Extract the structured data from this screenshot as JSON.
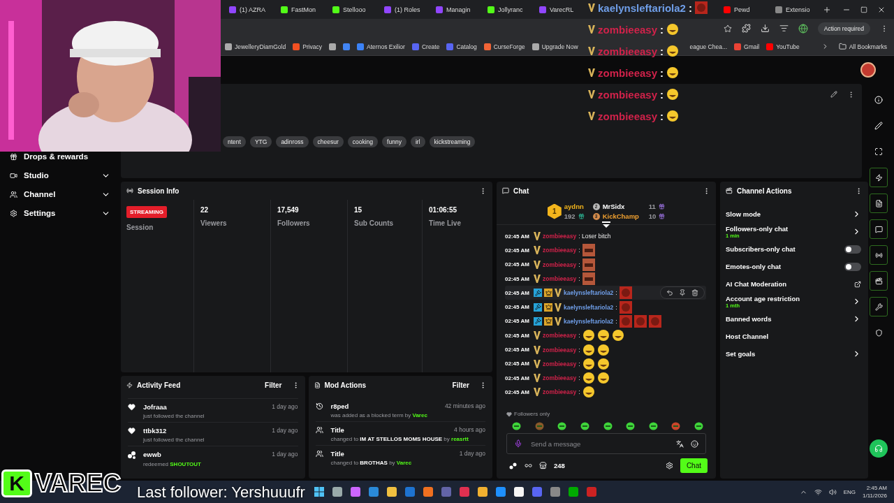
{
  "browser": {
    "tabs": [
      {
        "label": "(1) AZRA",
        "kind": "twitch"
      },
      {
        "label": "FastMon",
        "kind": "kick"
      },
      {
        "label": "Stellooo",
        "kind": "kick"
      },
      {
        "label": "(1) Roles",
        "kind": "twitch"
      },
      {
        "label": "Managin",
        "kind": "twitch"
      },
      {
        "label": "Jollyranc",
        "kind": "kick"
      },
      {
        "label": "VarecRL",
        "kind": "twitch"
      },
      {
        "label": "Pewd",
        "kind": "youtube"
      },
      {
        "label": "Extensio",
        "kind": "puzzle"
      }
    ],
    "action_required": "Action required",
    "bookmarks": [
      {
        "label": "JewelleryDiamGold",
        "kind": "globe"
      },
      {
        "label": "Privacy",
        "kind": "windows"
      },
      {
        "kind": "globe"
      },
      {
        "kind": "google"
      },
      {
        "label": "Aternos Exilior",
        "kind": "square"
      },
      {
        "label": "Create",
        "kind": "roblox"
      },
      {
        "label": "Catalog",
        "kind": "roblox"
      },
      {
        "label": "CurseForge",
        "kind": "curseforge"
      },
      {
        "label": "Upgrade Now",
        "kind": "globe"
      },
      {
        "label": "eague Chea...",
        "kind": "none"
      },
      {
        "label": "Gmail",
        "kind": "gmail"
      },
      {
        "label": "YouTube",
        "kind": "youtube"
      }
    ],
    "all_bookmarks": "All Bookmarks"
  },
  "sidebar": {
    "items": [
      {
        "label": "Drops & rewards",
        "kind": "gift",
        "expandable": false
      },
      {
        "label": "Studio",
        "kind": "studio",
        "expandable": true
      },
      {
        "label": "Channel",
        "kind": "channel",
        "expandable": true
      },
      {
        "label": "Settings",
        "kind": "settings",
        "expandable": true
      }
    ]
  },
  "stream_info": {
    "tags": [
      "ntent",
      "YTG",
      "adinross",
      "cheesur",
      "cooking",
      "funny",
      "irl",
      "kickstreaming"
    ]
  },
  "session_info": {
    "title": "Session Info",
    "status": "STREAMING",
    "session_label": "Session",
    "stats": [
      {
        "value": "22",
        "label": "Viewers"
      },
      {
        "value": "17,549",
        "label": "Followers"
      },
      {
        "value": "15",
        "label": "Sub Counts"
      },
      {
        "value": "01:06:55",
        "label": "Time Live"
      }
    ]
  },
  "chat": {
    "title": "Chat",
    "leaderboard": [
      {
        "rank": "1",
        "name": "aydnn",
        "count": "192"
      },
      {
        "rank": "2",
        "name": "MrSidx",
        "count": "11"
      },
      {
        "rank": "3",
        "name": "KickChamp",
        "count": "10"
      }
    ],
    "messages": [
      {
        "time": "02:45 AM",
        "badges": [
          {
            "kind": "vip"
          }
        ],
        "user": "zombieeasy",
        "color": "#d0224a",
        "text": ": Loser bitch",
        "selected": false
      },
      {
        "time": "02:45 AM",
        "badges": [
          {
            "kind": "vip"
          }
        ],
        "user": "zombieeasy",
        "color": "#d0224a",
        "text": ":",
        "emotes": [
          {
            "kind": "face"
          }
        ],
        "selected": false
      },
      {
        "time": "02:45 AM",
        "badges": [
          {
            "kind": "vip"
          }
        ],
        "user": "zombieeasy",
        "color": "#d0224a",
        "text": ":",
        "emotes": [
          {
            "kind": "face"
          }
        ],
        "selected": false
      },
      {
        "time": "02:45 AM",
        "badges": [
          {
            "kind": "vip"
          }
        ],
        "user": "zombieeasy",
        "color": "#d0224a",
        "text": ":",
        "emotes": [
          {
            "kind": "face"
          }
        ],
        "selected": false
      },
      {
        "time": "02:45 AM",
        "badges": [
          {
            "kind": "mod"
          },
          {
            "kind": "crown"
          },
          {
            "kind": "vip"
          }
        ],
        "user": "kaelynsleftariola2",
        "color": "#6f9ee8",
        "text": ":",
        "emotes": [
          {
            "kind": "red"
          }
        ],
        "selected": true
      },
      {
        "time": "02:45 AM",
        "badges": [
          {
            "kind": "mod"
          },
          {
            "kind": "crown"
          },
          {
            "kind": "vip"
          }
        ],
        "user": "kaelynsleftariola2",
        "color": "#6f9ee8",
        "text": ":",
        "emotes": [
          {
            "kind": "red"
          }
        ],
        "selected": false
      },
      {
        "time": "02:45 AM",
        "badges": [
          {
            "kind": "mod"
          },
          {
            "kind": "crown"
          },
          {
            "kind": "vip"
          }
        ],
        "user": "kaelynsleftariola2",
        "color": "#6f9ee8",
        "text": ":",
        "emotes": [
          {
            "kind": "red"
          },
          {
            "kind": "red"
          },
          {
            "kind": "red"
          }
        ],
        "selected": false
      },
      {
        "time": "02:45 AM",
        "badges": [
          {
            "kind": "vip"
          }
        ],
        "user": "zombieeasy",
        "color": "#d0224a",
        "text": ":",
        "emotes": [
          {
            "kind": "laugh"
          },
          {
            "kind": "laugh"
          },
          {
            "kind": "laugh"
          }
        ],
        "selected": false
      },
      {
        "time": "02:45 AM",
        "badges": [
          {
            "kind": "vip"
          }
        ],
        "user": "zombieeasy",
        "color": "#d0224a",
        "text": ":",
        "emotes": [
          {
            "kind": "laugh"
          },
          {
            "kind": "laugh"
          }
        ],
        "selected": false
      },
      {
        "time": "02:45 AM",
        "badges": [
          {
            "kind": "vip"
          }
        ],
        "user": "zombieeasy",
        "color": "#d0224a",
        "text": ":",
        "emotes": [
          {
            "kind": "laugh"
          },
          {
            "kind": "laugh"
          }
        ],
        "selected": false
      },
      {
        "time": "02:45 AM",
        "badges": [
          {
            "kind": "vip"
          }
        ],
        "user": "zombieeasy",
        "color": "#d0224a",
        "text": ":",
        "emotes": [
          {
            "kind": "laugh"
          },
          {
            "kind": "laugh"
          }
        ],
        "selected": false
      },
      {
        "time": "02:45 AM",
        "badges": [
          {
            "kind": "vip"
          }
        ],
        "user": "zombieeasy",
        "color": "#d0224a",
        "text": ":",
        "emotes": [
          {
            "kind": "laugh"
          }
        ],
        "selected": false
      }
    ],
    "followers_only": "Followers only",
    "placeholder": "Send a message",
    "points": "248",
    "send": "Chat"
  },
  "channel_actions": {
    "title": "Channel Actions",
    "items": [
      {
        "label": "Slow mode",
        "kind": "arrow"
      },
      {
        "label": "Followers-only chat",
        "sub": "1 min",
        "kind": "arrow"
      },
      {
        "label": "Subscribers-only chat",
        "kind": "toggle",
        "on": false
      },
      {
        "label": "Emotes-only chat",
        "kind": "toggle",
        "on": false
      },
      {
        "label": "AI Chat Moderation",
        "kind": "external"
      },
      {
        "label": "Account age restriction",
        "sub": "1 mth",
        "kind": "arrow"
      },
      {
        "label": "Banned words",
        "kind": "arrow"
      },
      {
        "label": "Host Channel",
        "kind": "plain"
      },
      {
        "label": "Set goals",
        "kind": "arrow"
      }
    ]
  },
  "activity_feed": {
    "title": "Activity Feed",
    "filter": "Filter",
    "items": [
      {
        "kind": "follow",
        "name": "Jofraaa",
        "detail": "just followed the channel",
        "time": "1 day ago"
      },
      {
        "kind": "follow",
        "name": "ttbk312",
        "detail": "just followed the channel",
        "time": "1 day ago"
      },
      {
        "kind": "redeem",
        "name": "ewwb",
        "detail": "redeemed",
        "highlight": "SHOUTOUT",
        "time": "1 day ago"
      }
    ]
  },
  "mod_actions": {
    "title": "Mod Actions",
    "filter": "Filter",
    "items": [
      {
        "kind": "blocked",
        "name": "r8ped",
        "detail": "was added as a blocked term",
        "by": "by",
        "actor": "Varec",
        "time": "42 minutes ago"
      },
      {
        "kind": "title",
        "name": "Title",
        "detail": "changed to",
        "value": "IM AT STELLOS MOMS HOUSE",
        "by": "by",
        "actor": "reasrtt",
        "time": "4 hours ago"
      },
      {
        "kind": "title",
        "name": "Title",
        "detail": "changed to",
        "value": "BROTHAS",
        "by": "by",
        "actor": "Varec",
        "time": "1 day ago"
      }
    ]
  },
  "overlay": {
    "chat": [
      {
        "user": "kaelynsleftariola2",
        "text": ":",
        "color": "#6f9ee8",
        "emotes": [
          {
            "kind": "red"
          }
        ]
      },
      {
        "user": "zombieeasy",
        "text": ":",
        "color": "#d0224a",
        "emotes": [
          {
            "kind": "laugh"
          }
        ]
      },
      {
        "user": "zombieeasy",
        "text": ":",
        "color": "#d0224a",
        "emotes": [
          {
            "kind": "laugh"
          }
        ]
      },
      {
        "user": "zombieeasy",
        "text": ":",
        "color": "#d0224a",
        "emotes": [
          {
            "kind": "laugh"
          }
        ]
      },
      {
        "user": "zombieeasy",
        "text": ":",
        "color": "#d0224a",
        "emotes": [
          {
            "kind": "laugh"
          }
        ]
      },
      {
        "user": "zombieeasy",
        "text": ":",
        "color": "#d0224a",
        "emotes": [
          {
            "kind": "laugh"
          }
        ]
      }
    ],
    "logo_mark": "K",
    "logo_name": "VAREC",
    "last_follower": "Last follower: Yershuuufr"
  },
  "taskbar": {
    "language": "ENG",
    "time": "2:45 AM",
    "date": "1/11/2026"
  }
}
